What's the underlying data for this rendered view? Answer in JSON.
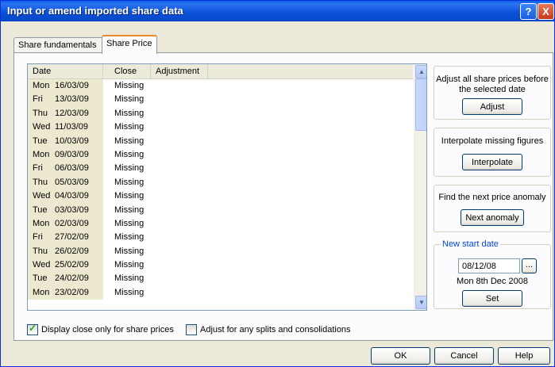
{
  "window": {
    "title": "Input or amend imported share data",
    "help_glyph": "?",
    "close_glyph": "X"
  },
  "tabs": [
    {
      "label": "Share fundamentals"
    },
    {
      "label": "Share Price"
    }
  ],
  "list": {
    "columns": [
      "Date",
      "Close",
      "Adjustment"
    ],
    "rows": [
      {
        "dow": "Mon",
        "date": "16/03/09",
        "close": "Missing",
        "adj": ""
      },
      {
        "dow": "Fri",
        "date": "13/03/09",
        "close": "Missing",
        "adj": ""
      },
      {
        "dow": "Thu",
        "date": "12/03/09",
        "close": "Missing",
        "adj": ""
      },
      {
        "dow": "Wed",
        "date": "11/03/09",
        "close": "Missing",
        "adj": ""
      },
      {
        "dow": "Tue",
        "date": "10/03/09",
        "close": "Missing",
        "adj": ""
      },
      {
        "dow": "Mon",
        "date": "09/03/09",
        "close": "Missing",
        "adj": ""
      },
      {
        "dow": "Fri",
        "date": "06/03/09",
        "close": "Missing",
        "adj": ""
      },
      {
        "dow": "Thu",
        "date": "05/03/09",
        "close": "Missing",
        "adj": ""
      },
      {
        "dow": "Wed",
        "date": "04/03/09",
        "close": "Missing",
        "adj": ""
      },
      {
        "dow": "Tue",
        "date": "03/03/09",
        "close": "Missing",
        "adj": ""
      },
      {
        "dow": "Mon",
        "date": "02/03/09",
        "close": "Missing",
        "adj": ""
      },
      {
        "dow": "Fri",
        "date": "27/02/09",
        "close": "Missing",
        "adj": ""
      },
      {
        "dow": "Thu",
        "date": "26/02/09",
        "close": "Missing",
        "adj": ""
      },
      {
        "dow": "Wed",
        "date": "25/02/09",
        "close": "Missing",
        "adj": ""
      },
      {
        "dow": "Tue",
        "date": "24/02/09",
        "close": "Missing",
        "adj": ""
      },
      {
        "dow": "Mon",
        "date": "23/02/09",
        "close": "Missing",
        "adj": ""
      }
    ]
  },
  "panel": {
    "adjust": {
      "text": "Adjust all share prices before the selected date",
      "button": "Adjust"
    },
    "interpolate": {
      "text": "Interpolate missing figures",
      "button": "Interpolate"
    },
    "anomaly": {
      "text": "Find the next price anomaly",
      "button": "Next anomaly"
    },
    "start_date": {
      "legend": "New start date",
      "value": "08/12/08",
      "browse": "...",
      "long_date": "Mon 8th Dec 2008",
      "button": "Set"
    }
  },
  "options": {
    "display_close_only": {
      "label": "Display close only for share prices",
      "checked": true
    },
    "adjust_splits": {
      "label": "Adjust for any splits and consolidations",
      "checked": false
    }
  },
  "footer": {
    "ok": "OK",
    "cancel": "Cancel",
    "help": "Help"
  },
  "colors": {
    "title_bar": "#0a4fd6",
    "legend": "#0046d5",
    "tab_accent": "#e68b2c"
  }
}
